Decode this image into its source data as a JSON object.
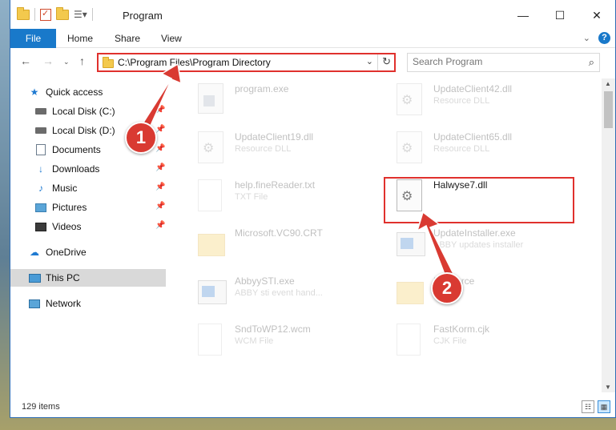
{
  "window": {
    "title": "Program",
    "minimize": "—",
    "maximize": "☐",
    "close": "✕"
  },
  "ribbon": {
    "tabs": [
      "File",
      "Home",
      "Share",
      "View"
    ],
    "expand_icon": "chevron-down-icon",
    "help_label": "?"
  },
  "address": {
    "path": "C:\\Program Files\\Program Directory",
    "search_placeholder": "Search Program"
  },
  "sidebar": {
    "items": [
      {
        "label": "Quick access",
        "icon": "star-icon",
        "pinned": false
      },
      {
        "label": "Local Disk (C:)",
        "icon": "drive-icon",
        "pinned": true
      },
      {
        "label": "Local Disk (D:)",
        "icon": "drive-icon",
        "pinned": true
      },
      {
        "label": "Documents",
        "icon": "document-icon",
        "pinned": true
      },
      {
        "label": "Downloads",
        "icon": "download-icon",
        "pinned": true
      },
      {
        "label": "Music",
        "icon": "music-icon",
        "pinned": true
      },
      {
        "label": "Pictures",
        "icon": "pictures-icon",
        "pinned": true
      },
      {
        "label": "Videos",
        "icon": "videos-icon",
        "pinned": true
      },
      {
        "label": "OneDrive",
        "icon": "cloud-icon",
        "pinned": false
      },
      {
        "label": "This PC",
        "icon": "computer-icon",
        "pinned": false
      },
      {
        "label": "Network",
        "icon": "network-icon",
        "pinned": false
      }
    ]
  },
  "files": [
    {
      "name": "program.exe",
      "type": "",
      "icon": "program-icon",
      "faded": true
    },
    {
      "name": "UpdateClient42.dll",
      "type": "Resource DLL",
      "icon": "dll-icon",
      "faded": true
    },
    {
      "name": "UpdateClient19.dll",
      "type": "Resource DLL",
      "icon": "dll-icon",
      "faded": true
    },
    {
      "name": "UpdateClient65.dll",
      "type": "Resource DLL",
      "icon": "dll-icon",
      "faded": true
    },
    {
      "name": "help.fineReader.txt",
      "type": "TXT File",
      "icon": "text-file-icon",
      "faded": true
    },
    {
      "name": "Halwyse7.dll",
      "type": "",
      "icon": "dll-icon",
      "faded": false
    },
    {
      "name": "Microsoft.VC90.CRT",
      "type": "",
      "icon": "folder-icon",
      "faded": true
    },
    {
      "name": "UpdateInstaller.exe",
      "type": "ABBY updates installer",
      "icon": "exe-icon",
      "faded": true
    },
    {
      "name": "AbbyySTI.exe",
      "type": "ABBY sti event hand...",
      "icon": "exe-icon",
      "faded": true
    },
    {
      "name": "Resource",
      "type": "",
      "icon": "folder-icon",
      "faded": true
    },
    {
      "name": "SndToWP12.wcm",
      "type": "WCM File",
      "icon": "text-file-icon",
      "faded": true
    },
    {
      "name": "FastKorm.cjk",
      "type": "CJK File",
      "icon": "text-file-icon",
      "faded": true
    }
  ],
  "status": {
    "item_count": "129 items"
  },
  "annotations": {
    "step1": "1",
    "step2": "2",
    "color": "#d93a32"
  }
}
